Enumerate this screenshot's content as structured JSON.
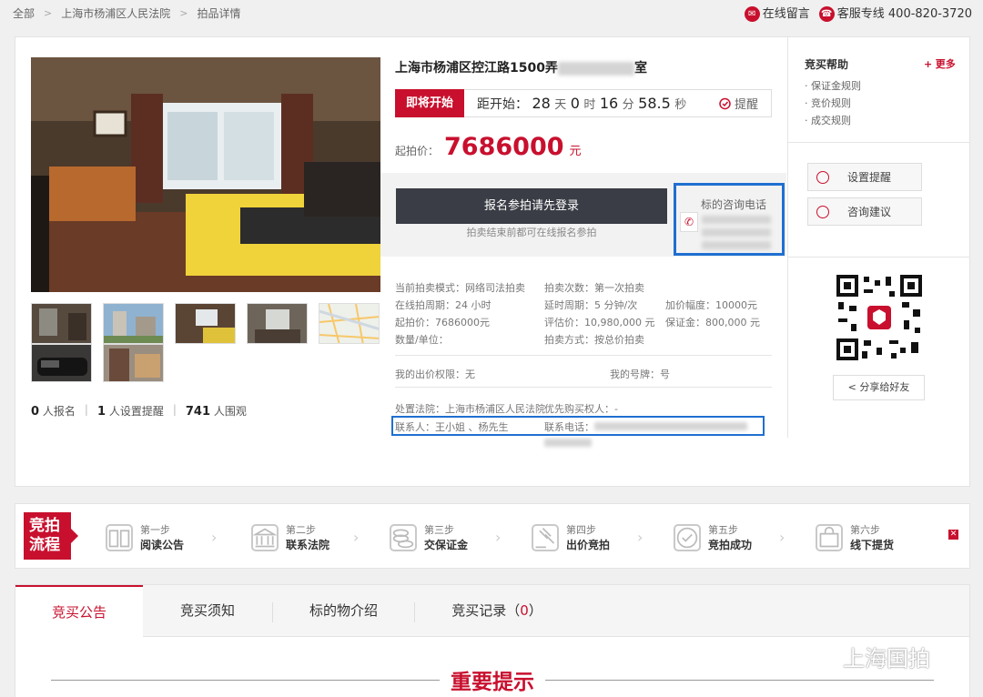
{
  "breadcrumb": [
    "全部",
    "上海市杨浦区人民法院",
    "拍品详情"
  ],
  "top_links": {
    "message": "在线留言",
    "hotline_label": "客服专线",
    "hotline_number": "400-820-3720"
  },
  "lot": {
    "title": "上海市杨浦区控江路1500弄",
    "title_suffix": "室",
    "status_tag": "即将开始",
    "countdown_prefix": "距开始：",
    "days": "28",
    "days_unit": "天",
    "hours": "0",
    "hours_unit": "时",
    "minutes": "16",
    "minutes_unit": "分",
    "seconds": "58.5",
    "seconds_unit": "秒",
    "remind": "提醒",
    "price_label": "起拍价：",
    "price": "7686000",
    "price_unit": "元",
    "login_button": "报名参拍请先登录",
    "login_note": "拍卖结束前都可在线报名参拍",
    "consult_label": "标的咨询电话"
  },
  "stats": {
    "signup_count": "0",
    "signup_label": "人报名",
    "remind_count": "1",
    "remind_label": "人设置提醒",
    "view_count": "741",
    "view_label": "人围观"
  },
  "details": {
    "mode": "当前拍卖模式：网络司法拍卖",
    "round": "拍卖次数：第一次拍卖",
    "period": "在线拍周期：24 小时",
    "delay": "延时周期：5 分钟/次",
    "increment": "加价幅度：10000元",
    "start_price": "起拍价：7686000元",
    "valuation": "评估价：10,980,000 元",
    "deposit": "保证金：800,000 元",
    "quantity": "数量/单位：",
    "method": "拍卖方式：按总价拍卖",
    "bid_right": "我的出价权限：无",
    "bid_no": "我的号牌：号",
    "court": "处置法院：上海市杨浦区人民法院",
    "priority": "优先购买权人：-",
    "contact": "联系人：王小姐 、杨先生",
    "phone_label": "联系电话："
  },
  "help": {
    "title": "竞买帮助",
    "more": "更多",
    "items": [
      "保证金规则",
      "竞价规则",
      "成交规则"
    ],
    "set_remind": "设置提醒",
    "advice": "咨询建议",
    "share": "分享给好友"
  },
  "process": {
    "label": "竞拍流程",
    "steps": [
      {
        "num": "第一步",
        "name": "阅读公告"
      },
      {
        "num": "第二步",
        "name": "联系法院"
      },
      {
        "num": "第三步",
        "name": "交保证金"
      },
      {
        "num": "第四步",
        "name": "出价竞拍"
      },
      {
        "num": "第五步",
        "name": "竞拍成功"
      },
      {
        "num": "第六步",
        "name": "线下提货"
      }
    ]
  },
  "tabs": [
    {
      "label": "竞买公告"
    },
    {
      "label": "竞买须知"
    },
    {
      "label": "标的物介绍"
    },
    {
      "label": "竞买记录",
      "count": "0"
    }
  ],
  "notice_title": "重要提示",
  "watermark": "上海国拍"
}
